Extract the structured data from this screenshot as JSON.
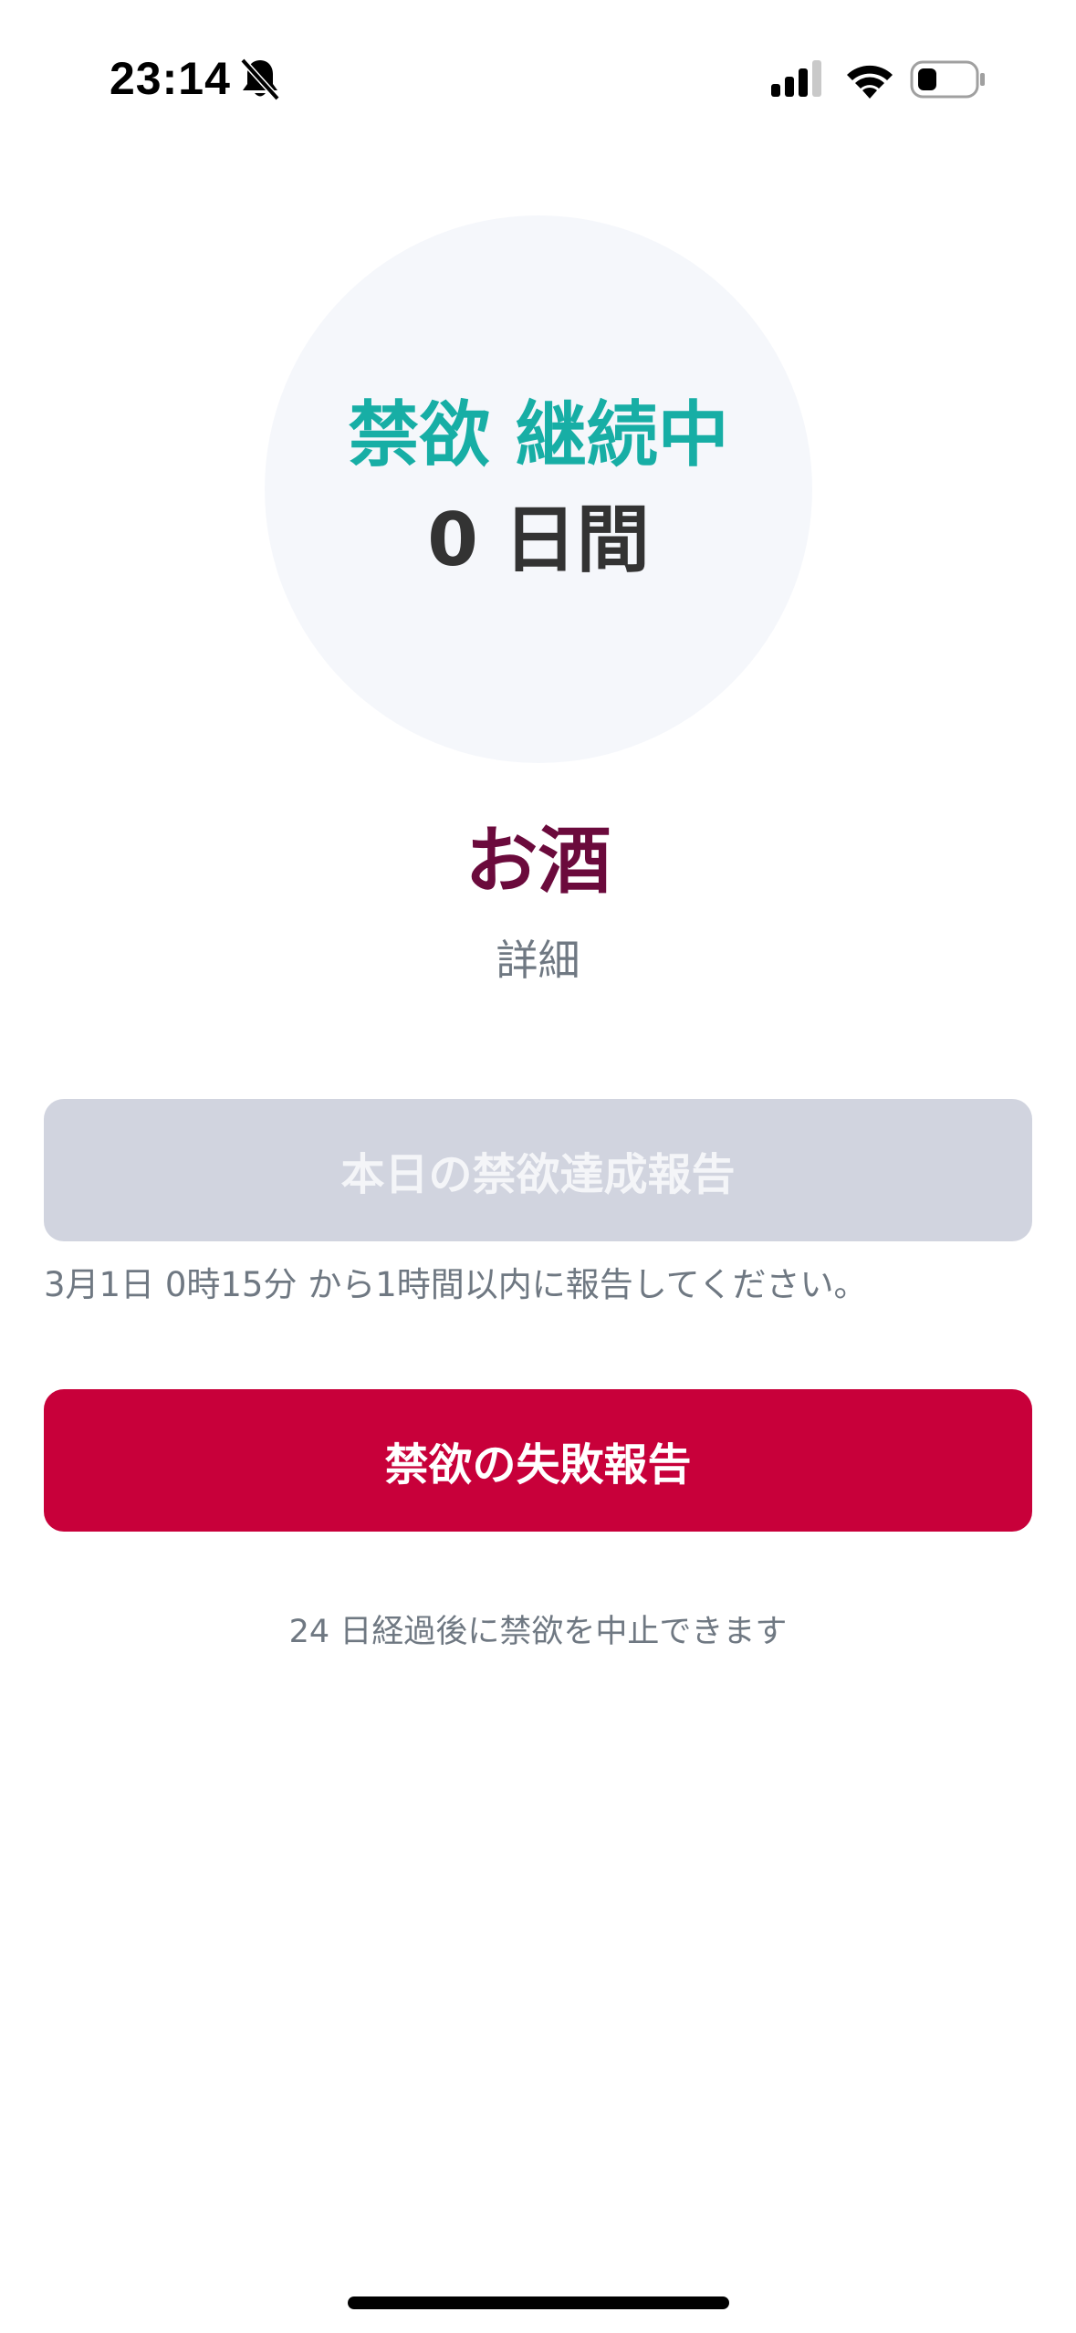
{
  "status_bar": {
    "time": "23:14",
    "icons": [
      "bell-slash-icon",
      "cellular-signal-icon",
      "wifi-icon",
      "battery-icon"
    ]
  },
  "streak": {
    "status": "禁欲 継続中",
    "days": "0 日間"
  },
  "target": {
    "title": "お酒",
    "detail_label": "詳細"
  },
  "actions": {
    "success_button_label": "本日の禁欲達成報告",
    "success_note": "3月1日 0時15分 から1時間以内に報告してください。",
    "fail_button_label": "禁欲の失敗報告",
    "stop_note": "24 日経過後に禁欲を中止できます"
  },
  "colors": {
    "accent": "#17aea5",
    "title": "#6b0a3c",
    "danger": "#c8003a",
    "disabled": "#d1d4df",
    "muted_text": "#6f7882"
  }
}
